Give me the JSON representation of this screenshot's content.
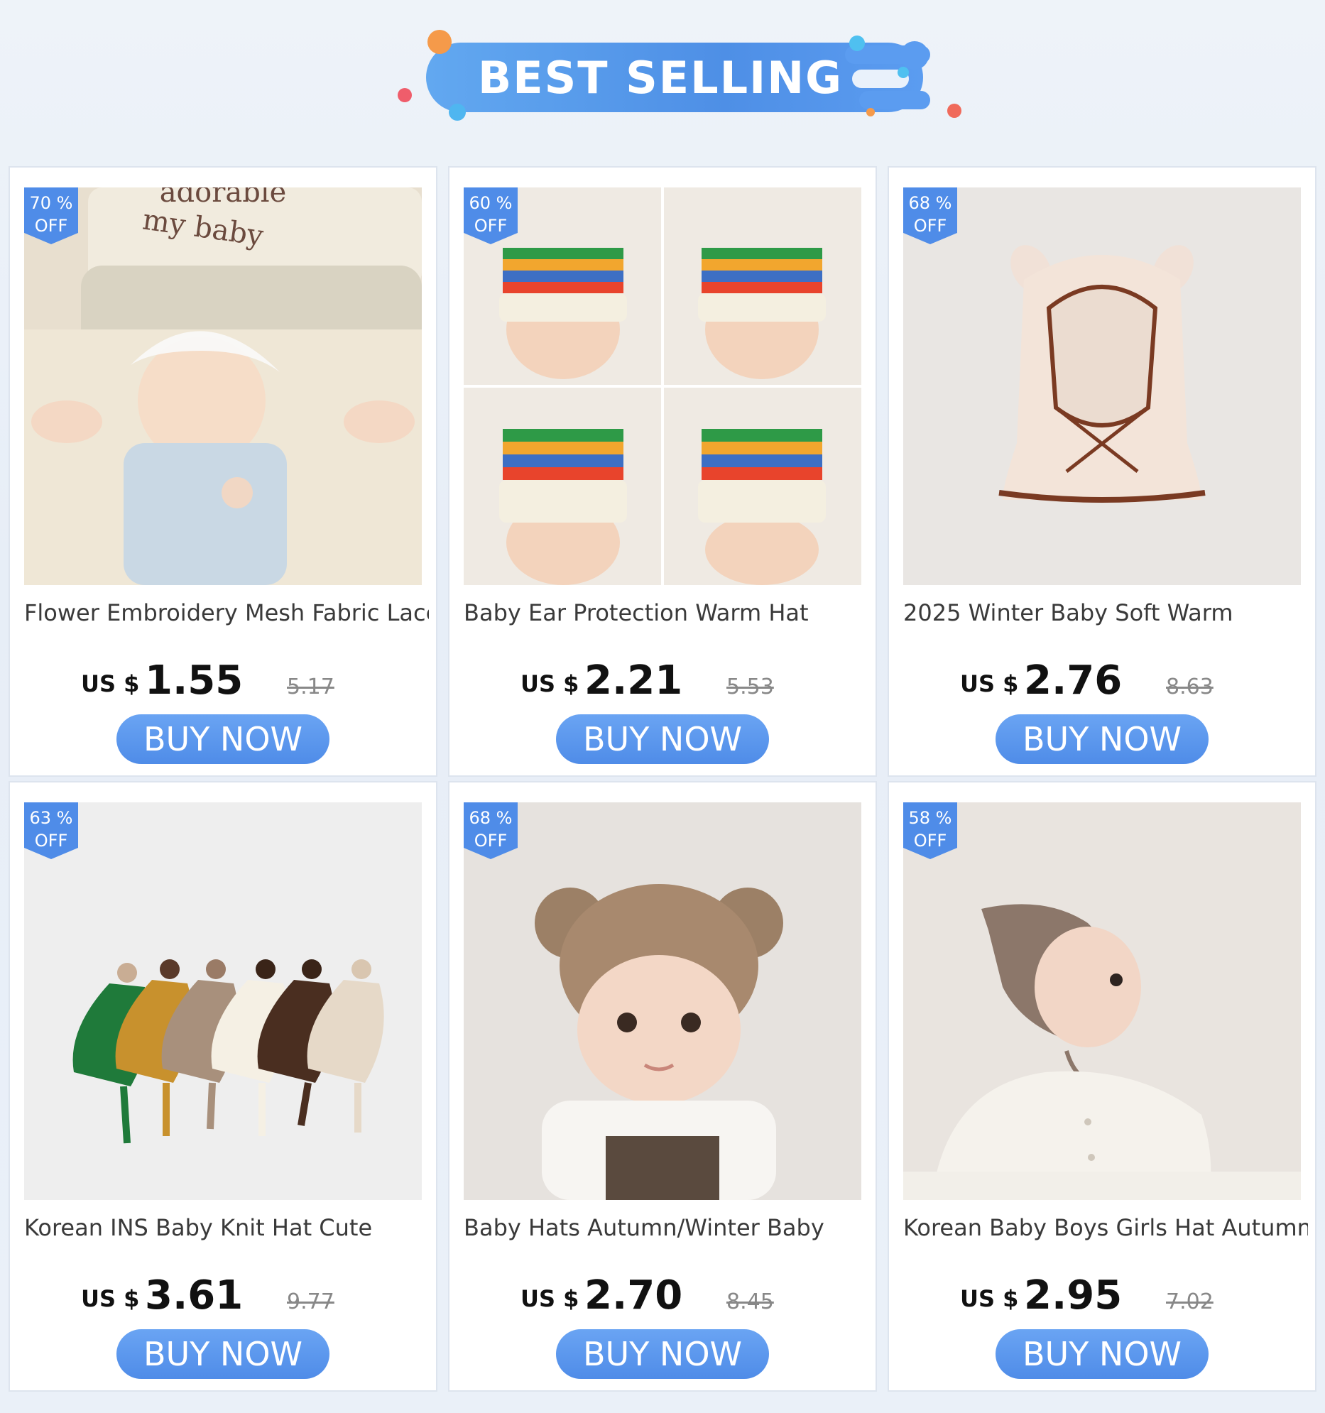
{
  "header": {
    "title": "BEST SELLING"
  },
  "colors": {
    "accent": "#4f8ce8",
    "badge": "#4f8ce8",
    "text": "#3a3a3a"
  },
  "products": [
    {
      "discount": "70 %",
      "off": "OFF",
      "title": "Flower Embroidery Mesh Fabric Lace",
      "currency": "US $",
      "price": "1.55",
      "original_price": "5.17",
      "cta": "BUY NOW"
    },
    {
      "discount": "60 %",
      "off": "OFF",
      "title": "Baby Ear Protection Warm Hat",
      "currency": "US $",
      "price": "2.21",
      "original_price": "5.53",
      "cta": "BUY NOW"
    },
    {
      "discount": "68 %",
      "off": "OFF",
      "title": "2025 Winter Baby Soft Warm",
      "currency": "US $",
      "price": "2.76",
      "original_price": "8.63",
      "cta": "BUY NOW"
    },
    {
      "discount": "63 %",
      "off": "OFF",
      "title": "Korean INS Baby Knit Hat Cute",
      "currency": "US $",
      "price": "3.61",
      "original_price": "9.77",
      "cta": "BUY NOW"
    },
    {
      "discount": "68 %",
      "off": "OFF",
      "title": "Baby Hats Autumn/Winter Baby",
      "currency": "US $",
      "price": "2.70",
      "original_price": "8.45",
      "cta": "BUY NOW"
    },
    {
      "discount": "58 %",
      "off": "OFF",
      "title": "Korean Baby Boys Girls Hat Autumn",
      "currency": "US $",
      "price": "2.95",
      "original_price": "7.02",
      "cta": "BUY NOW"
    }
  ]
}
